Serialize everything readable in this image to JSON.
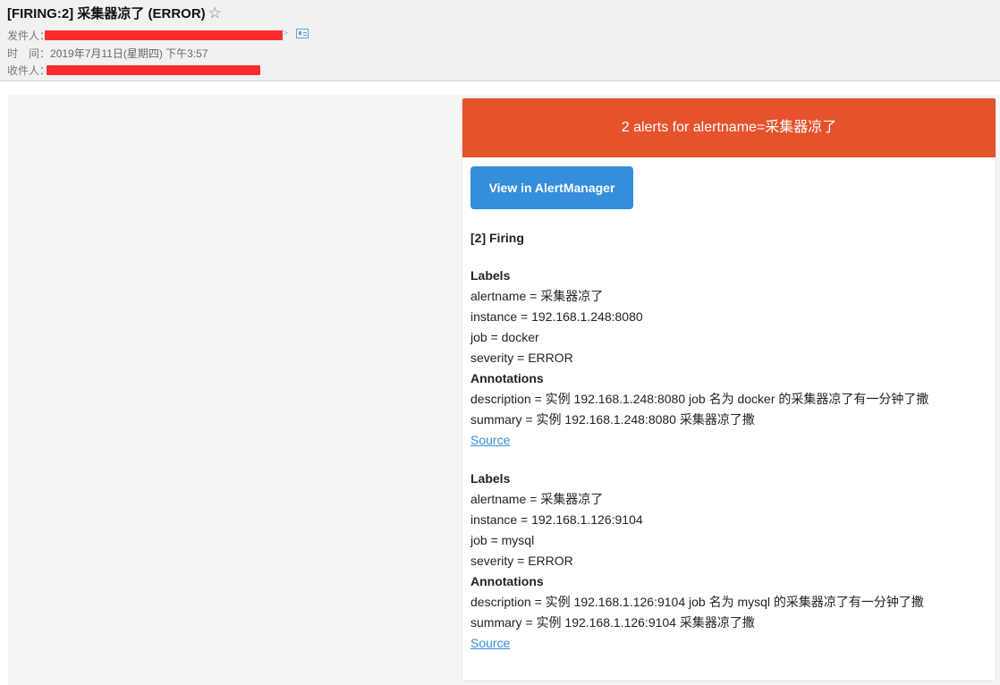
{
  "email": {
    "subject": "[FIRING:2] 采集器凉了 (ERROR)",
    "sender_label": "发件人：",
    "time_label": "时　间：",
    "time_value": "2019年7月11日(星期四) 下午3:57",
    "recipient_label": "收件人："
  },
  "alert": {
    "header_title": "2 alerts for alertname=采集器凉了",
    "button_label": "View in AlertManager",
    "firing_title": "[2] Firing",
    "labels_heading": "Labels",
    "annotations_heading": "Annotations",
    "source_label": "Source",
    "alerts": [
      {
        "alertname": "alertname = 采集器凉了",
        "instance": "instance = 192.168.1.248:8080",
        "job": "job = docker",
        "severity": "severity = ERROR",
        "description": "description = 实例 192.168.1.248:8080 job 名为 docker 的采集器凉了有一分钟了撒",
        "summary": "summary = 实例 192.168.1.248:8080 采集器凉了撒"
      },
      {
        "alertname": "alertname = 采集器凉了",
        "instance": "instance = 192.168.1.126:9104",
        "job": "job = mysql",
        "severity": "severity = ERROR",
        "description": "description = 实例 192.168.1.126:9104 job 名为 mysql 的采集器凉了有一分钟了撒",
        "summary": "summary = 实例 192.168.1.126:9104 采集器凉了撒"
      }
    ]
  },
  "colors": {
    "header_red": "#e6522c",
    "button_blue": "#348eda",
    "redaction": "#ff2b2b"
  }
}
